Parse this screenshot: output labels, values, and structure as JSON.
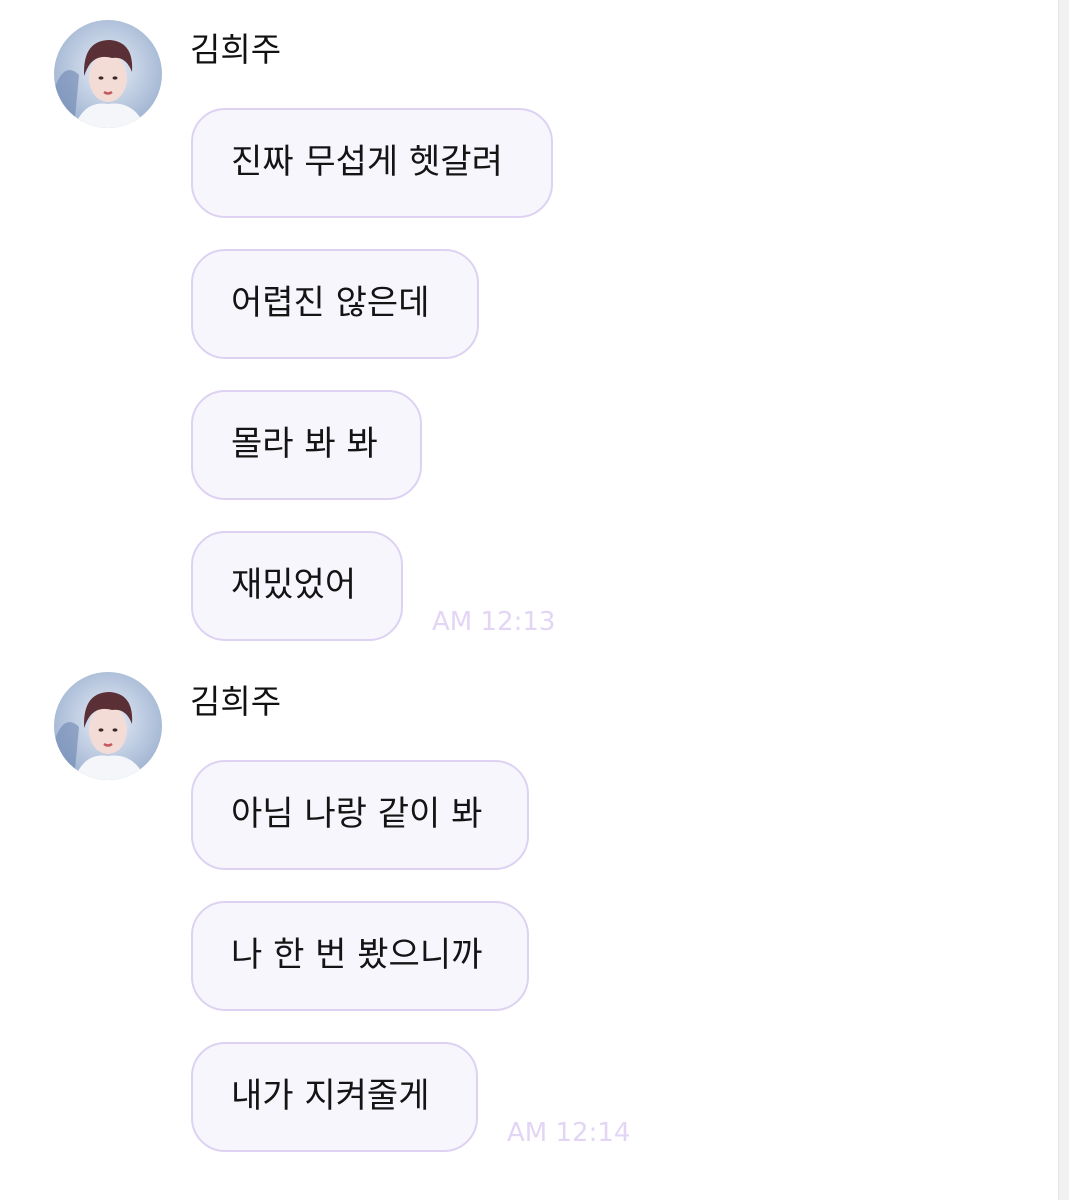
{
  "colors": {
    "background": "#ffffff",
    "bubble_fill": "#f7f6fd",
    "bubble_border": "#ddd2f2",
    "timestamp": "#e3d6f4",
    "text": "#141414"
  },
  "groups": [
    {
      "sender": "김희주",
      "avatar_icon": "profile-photo",
      "messages": [
        "진짜 무섭게 헷갈려",
        "어렵진 않은데",
        "몰라 봐 봐",
        "재밌었어"
      ],
      "time": "AM 12:13"
    },
    {
      "sender": "김희주",
      "avatar_icon": "profile-photo",
      "messages": [
        "아님 나랑 같이 봐",
        "나 한 번 봤으니까",
        "내가 지켜줄게"
      ],
      "time": "AM 12:14"
    }
  ]
}
